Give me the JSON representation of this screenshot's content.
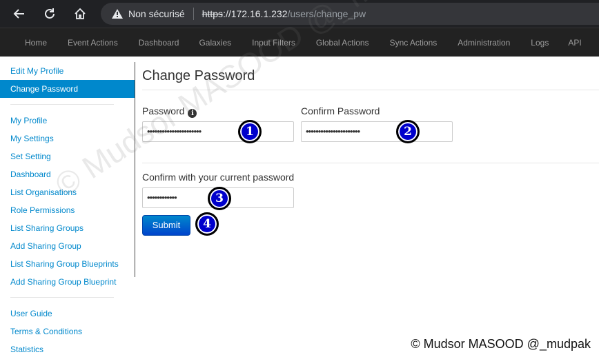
{
  "browser": {
    "security_label": "Non sécurisé",
    "url_protocol": "https",
    "url_host": "://172.16.1.232",
    "url_path": "/users/change_pw"
  },
  "navbar": {
    "items": [
      "Home",
      "Event Actions",
      "Dashboard",
      "Galaxies",
      "Input Filters",
      "Global Actions",
      "Sync Actions",
      "Administration",
      "Logs",
      "API"
    ]
  },
  "sidebar": {
    "items": [
      {
        "label": "Edit My Profile",
        "active": false
      },
      {
        "label": "Change Password",
        "active": true
      },
      {
        "label": "My Profile",
        "active": false
      },
      {
        "label": "My Settings",
        "active": false
      },
      {
        "label": "Set Setting",
        "active": false
      },
      {
        "label": "Dashboard",
        "active": false
      },
      {
        "label": "List Organisations",
        "active": false
      },
      {
        "label": "Role Permissions",
        "active": false
      },
      {
        "label": "List Sharing Groups",
        "active": false
      },
      {
        "label": "Add Sharing Group",
        "active": false
      },
      {
        "label": "List Sharing Group Blueprints",
        "active": false
      },
      {
        "label": "Add Sharing Group Blueprint",
        "active": false
      },
      {
        "label": "User Guide",
        "active": false
      },
      {
        "label": "Terms & Conditions",
        "active": false
      },
      {
        "label": "Statistics",
        "active": false
      }
    ]
  },
  "form": {
    "title": "Change Password",
    "password_label": "Password",
    "password_value": "••••••••••••••••••••••",
    "confirm_label": "Confirm Password",
    "confirm_value": "••••••••••••••••••••••",
    "current_label": "Confirm with your current password",
    "current_value": "••••••••••••",
    "submit_label": "Submit"
  },
  "annotations": {
    "step1": "1",
    "step2": "2",
    "step3": "3",
    "step4": "4",
    "watermark": "© Mudsor MASOOD @_mudpak",
    "credit": "© Mudsor MASOOD @_mudpak"
  },
  "colors": {
    "accent": "#0088cc",
    "navbar_bg": "#222222",
    "badge_fill": "#0000cc"
  }
}
